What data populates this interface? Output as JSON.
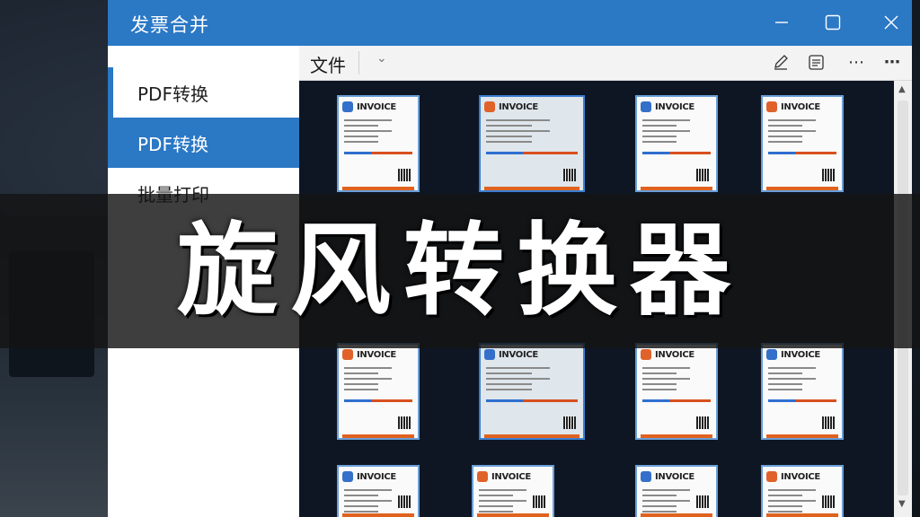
{
  "window": {
    "title": "发票合并",
    "controls": [
      "minimize-icon",
      "maximize-icon",
      "close-icon"
    ]
  },
  "sidebar": {
    "items": [
      {
        "label": "PDF转换",
        "state": "indicator"
      },
      {
        "label": "PDF转换",
        "state": "selected"
      },
      {
        "label": "批量打印",
        "state": "normal"
      }
    ]
  },
  "toolbar": {
    "file_label": "文件",
    "icons": [
      "chevron-down-icon",
      "pen-icon",
      "notes-icon",
      "more-icon",
      "more-icon"
    ]
  },
  "thumbnails": {
    "doc_label": "INVOICE",
    "label_variants": [
      "INVOICE",
      "INVOICE",
      "INVOICE",
      "INVOICE",
      "INVOICE",
      "INVOICE",
      "INVOICE",
      "INVOICE",
      "INVOICE",
      "INVOICE",
      "INVOICE",
      "INVOICE",
      "INVOICE",
      "INVOICE"
    ]
  },
  "banner": {
    "text": "旋风转换器"
  },
  "colors": {
    "accent": "#2b78c5",
    "content_bg": "#0e1623",
    "banner_bg": "#141414"
  }
}
